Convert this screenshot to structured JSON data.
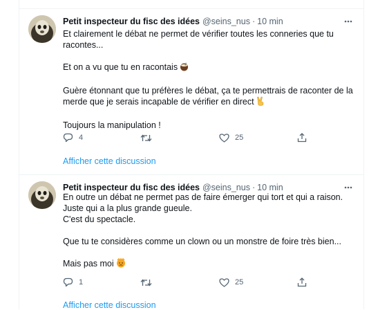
{
  "tweets": [
    {
      "author_name": "Petit inspecteur du fisc des idées",
      "handle": "@seins_nus",
      "separator": "·",
      "time": "10 min",
      "lines": [
        "Et clairement le débat ne permet de vérifier toutes les conneries que tu",
        "racontes...",
        "",
        "Et on a vu que tu en racontais",
        "",
        "Guère étonnant que tu préfères le débat, ça te permettrais de raconter de la",
        "merde que je serais incapable de vérifier en direct",
        "",
        "Toujours la manipulation !"
      ],
      "reply_count": "4",
      "retweet_count": "",
      "like_count": "25",
      "thread_link": "Afficher cette discussion"
    },
    {
      "author_name": "Petit inspecteur du fisc des idées",
      "handle": "@seins_nus",
      "separator": "·",
      "time": "10 min",
      "lines": [
        "En outre un débat ne permet pas de faire émerger qui  tort et qui a raison.",
        "Juste qui a la plus grande gueule.",
        "C'est du spectacle.",
        "",
        "Que tu te considères comme un clown ou un monstre de foire très bien...",
        "",
        "Mais pas moi"
      ],
      "reply_count": "1",
      "retweet_count": "",
      "like_count": "25",
      "thread_link": "Afficher cette discussion"
    }
  ],
  "icons": {
    "more": "more-icon",
    "reply": "reply-icon",
    "retweet": "retweet-icon",
    "like": "heart-icon",
    "share": "share-icon",
    "emoji_1": "coconut-emoji",
    "emoji_2": "victory-hand-emoji",
    "emoji_3": "angry-face-emoji"
  },
  "colors": {
    "text": "#0f1419",
    "secondary": "#536471",
    "link": "#1d9bf0",
    "divider": "#eff3f4"
  }
}
